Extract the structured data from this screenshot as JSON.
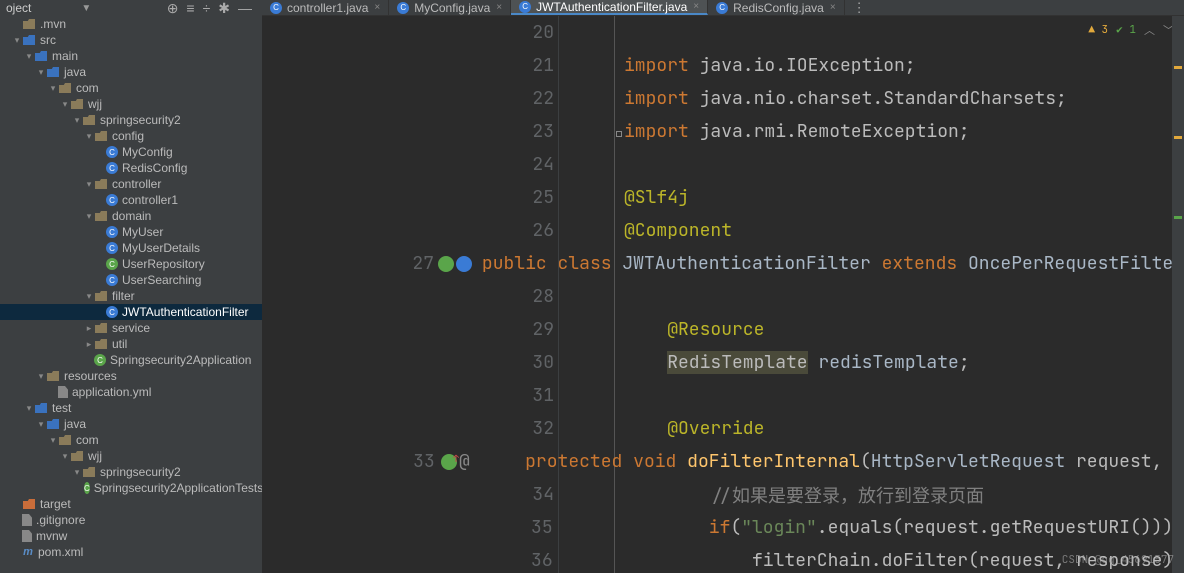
{
  "project_label": "oject",
  "tabs": [
    {
      "label": "controller1.java",
      "active": false
    },
    {
      "label": "MyConfig.java",
      "active": false
    },
    {
      "label": "JWTAuthenticationFilter.java",
      "active": true
    },
    {
      "label": "RedisConfig.java",
      "active": false
    }
  ],
  "status": {
    "warn": "3",
    "check": "1"
  },
  "tree": [
    {
      "d": 1,
      "a": "n",
      "ico": "fld",
      "label": ".mvn"
    },
    {
      "d": 1,
      "a": "o",
      "ico": "fld-blue",
      "label": "src"
    },
    {
      "d": 2,
      "a": "o",
      "ico": "fld-blue",
      "label": "main"
    },
    {
      "d": 3,
      "a": "o",
      "ico": "fld-blue",
      "label": "java"
    },
    {
      "d": 4,
      "a": "o",
      "ico": "fld",
      "label": "com"
    },
    {
      "d": 5,
      "a": "o",
      "ico": "fld",
      "label": "wjj"
    },
    {
      "d": 6,
      "a": "o",
      "ico": "fld",
      "label": "springsecurity2"
    },
    {
      "d": 7,
      "a": "o",
      "ico": "fld",
      "label": "config"
    },
    {
      "d": 8,
      "a": "n",
      "ico": "cls",
      "label": "MyConfig"
    },
    {
      "d": 8,
      "a": "n",
      "ico": "cls",
      "label": "RedisConfig"
    },
    {
      "d": 7,
      "a": "o",
      "ico": "fld",
      "label": "controller"
    },
    {
      "d": 8,
      "a": "n",
      "ico": "cls",
      "label": "controller1"
    },
    {
      "d": 7,
      "a": "o",
      "ico": "fld",
      "label": "domain"
    },
    {
      "d": 8,
      "a": "n",
      "ico": "cls",
      "label": "MyUser"
    },
    {
      "d": 8,
      "a": "n",
      "ico": "cls",
      "label": "MyUserDetails"
    },
    {
      "d": 8,
      "a": "n",
      "ico": "cls-g",
      "label": "UserRepository"
    },
    {
      "d": 8,
      "a": "n",
      "ico": "cls",
      "label": "UserSearching"
    },
    {
      "d": 7,
      "a": "o",
      "ico": "fld",
      "label": "filter"
    },
    {
      "d": 8,
      "a": "n",
      "ico": "cls",
      "label": "JWTAuthenticationFilter",
      "sel": true
    },
    {
      "d": 7,
      "a": "c",
      "ico": "fld",
      "label": "service"
    },
    {
      "d": 7,
      "a": "c",
      "ico": "fld",
      "label": "util"
    },
    {
      "d": 7,
      "a": "n",
      "ico": "cls-g",
      "label": "Springsecurity2Application"
    },
    {
      "d": 3,
      "a": "o",
      "ico": "fld",
      "label": "resources"
    },
    {
      "d": 4,
      "a": "n",
      "ico": "file",
      "label": "application.yml"
    },
    {
      "d": 2,
      "a": "o",
      "ico": "fld-blue",
      "label": "test"
    },
    {
      "d": 3,
      "a": "o",
      "ico": "fld-blue",
      "label": "java"
    },
    {
      "d": 4,
      "a": "o",
      "ico": "fld",
      "label": "com"
    },
    {
      "d": 5,
      "a": "o",
      "ico": "fld",
      "label": "wjj"
    },
    {
      "d": 6,
      "a": "o",
      "ico": "fld",
      "label": "springsecurity2"
    },
    {
      "d": 7,
      "a": "n",
      "ico": "cls-g",
      "label": "Springsecurity2ApplicationTests"
    },
    {
      "d": 1,
      "a": "n",
      "ico": "fld-orange",
      "label": "target"
    },
    {
      "d": 1,
      "a": "n",
      "ico": "file",
      "label": ".gitignore"
    },
    {
      "d": 1,
      "a": "n",
      "ico": "file",
      "label": "mvnw"
    },
    {
      "d": 1,
      "a": "n",
      "ico": "m",
      "label": "pom.xml"
    }
  ],
  "code": [
    {
      "n": 20,
      "html": ""
    },
    {
      "n": 21,
      "html": "<span class='kw'>import</span> java.io.IOException;"
    },
    {
      "n": 22,
      "html": "<span class='kw'>import</span> java.nio.charset.StandardCharsets;"
    },
    {
      "n": 23,
      "html": "<span class='kw'>import</span> java.rmi.RemoteException;",
      "fold": true
    },
    {
      "n": 24,
      "html": ""
    },
    {
      "n": 25,
      "html": "<span class='ann'>@Slf4j</span>"
    },
    {
      "n": 26,
      "html": "<span class='ann'>@Component</span>"
    },
    {
      "n": 27,
      "html": "<span class='kw'>public</span> <span class='kw'>class</span> <span class='typ'>JWTAuthenticationFilter</span> <span class='kw'>extends</span> <span class='typ'>OncePerRequestFilter</span>",
      "gut": "spring-bean"
    },
    {
      "n": 28,
      "html": ""
    },
    {
      "n": 29,
      "html": "    <span class='ann'>@Resource</span>"
    },
    {
      "n": 30,
      "html": "    <span class='hi'>RedisTemplate</span> <span class='param'>redisTemplate</span>;"
    },
    {
      "n": 31,
      "html": ""
    },
    {
      "n": 32,
      "html": "    <span class='ann'>@Override</span>"
    },
    {
      "n": 33,
      "html": "    <span class='kw'>protected</span> <span class='kw'>void</span> <span class='fn'>doFilterInternal</span>(<span class='typ'>HttpServletRequest</span> request, <span class='typ'>H</span>",
      "gut": "impl-at"
    },
    {
      "n": 34,
      "html": "        <span class='cmt'>//如果是要登录，放行到登录页面</span>"
    },
    {
      "n": 35,
      "html": "        <span class='kw'>if</span>(<span class='str'>\"login\"</span>.equals(request.getRequestURI())){"
    },
    {
      "n": 36,
      "html": "            filterChain.doFilter(request, response);"
    }
  ],
  "watermark": "CSDN @qq_45691577"
}
